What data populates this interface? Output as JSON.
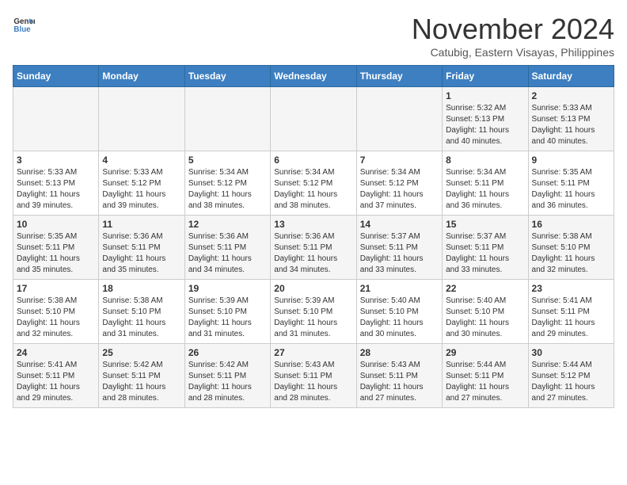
{
  "header": {
    "logo_line1": "General",
    "logo_line2": "Blue",
    "month": "November 2024",
    "location": "Catubig, Eastern Visayas, Philippines"
  },
  "weekdays": [
    "Sunday",
    "Monday",
    "Tuesday",
    "Wednesday",
    "Thursday",
    "Friday",
    "Saturday"
  ],
  "weeks": [
    [
      {
        "day": "",
        "info": ""
      },
      {
        "day": "",
        "info": ""
      },
      {
        "day": "",
        "info": ""
      },
      {
        "day": "",
        "info": ""
      },
      {
        "day": "",
        "info": ""
      },
      {
        "day": "1",
        "info": "Sunrise: 5:32 AM\nSunset: 5:13 PM\nDaylight: 11 hours\nand 40 minutes."
      },
      {
        "day": "2",
        "info": "Sunrise: 5:33 AM\nSunset: 5:13 PM\nDaylight: 11 hours\nand 40 minutes."
      }
    ],
    [
      {
        "day": "3",
        "info": "Sunrise: 5:33 AM\nSunset: 5:13 PM\nDaylight: 11 hours\nand 39 minutes."
      },
      {
        "day": "4",
        "info": "Sunrise: 5:33 AM\nSunset: 5:12 PM\nDaylight: 11 hours\nand 39 minutes."
      },
      {
        "day": "5",
        "info": "Sunrise: 5:34 AM\nSunset: 5:12 PM\nDaylight: 11 hours\nand 38 minutes."
      },
      {
        "day": "6",
        "info": "Sunrise: 5:34 AM\nSunset: 5:12 PM\nDaylight: 11 hours\nand 38 minutes."
      },
      {
        "day": "7",
        "info": "Sunrise: 5:34 AM\nSunset: 5:12 PM\nDaylight: 11 hours\nand 37 minutes."
      },
      {
        "day": "8",
        "info": "Sunrise: 5:34 AM\nSunset: 5:11 PM\nDaylight: 11 hours\nand 36 minutes."
      },
      {
        "day": "9",
        "info": "Sunrise: 5:35 AM\nSunset: 5:11 PM\nDaylight: 11 hours\nand 36 minutes."
      }
    ],
    [
      {
        "day": "10",
        "info": "Sunrise: 5:35 AM\nSunset: 5:11 PM\nDaylight: 11 hours\nand 35 minutes."
      },
      {
        "day": "11",
        "info": "Sunrise: 5:36 AM\nSunset: 5:11 PM\nDaylight: 11 hours\nand 35 minutes."
      },
      {
        "day": "12",
        "info": "Sunrise: 5:36 AM\nSunset: 5:11 PM\nDaylight: 11 hours\nand 34 minutes."
      },
      {
        "day": "13",
        "info": "Sunrise: 5:36 AM\nSunset: 5:11 PM\nDaylight: 11 hours\nand 34 minutes."
      },
      {
        "day": "14",
        "info": "Sunrise: 5:37 AM\nSunset: 5:11 PM\nDaylight: 11 hours\nand 33 minutes."
      },
      {
        "day": "15",
        "info": "Sunrise: 5:37 AM\nSunset: 5:11 PM\nDaylight: 11 hours\nand 33 minutes."
      },
      {
        "day": "16",
        "info": "Sunrise: 5:38 AM\nSunset: 5:10 PM\nDaylight: 11 hours\nand 32 minutes."
      }
    ],
    [
      {
        "day": "17",
        "info": "Sunrise: 5:38 AM\nSunset: 5:10 PM\nDaylight: 11 hours\nand 32 minutes."
      },
      {
        "day": "18",
        "info": "Sunrise: 5:38 AM\nSunset: 5:10 PM\nDaylight: 11 hours\nand 31 minutes."
      },
      {
        "day": "19",
        "info": "Sunrise: 5:39 AM\nSunset: 5:10 PM\nDaylight: 11 hours\nand 31 minutes."
      },
      {
        "day": "20",
        "info": "Sunrise: 5:39 AM\nSunset: 5:10 PM\nDaylight: 11 hours\nand 31 minutes."
      },
      {
        "day": "21",
        "info": "Sunrise: 5:40 AM\nSunset: 5:10 PM\nDaylight: 11 hours\nand 30 minutes."
      },
      {
        "day": "22",
        "info": "Sunrise: 5:40 AM\nSunset: 5:10 PM\nDaylight: 11 hours\nand 30 minutes."
      },
      {
        "day": "23",
        "info": "Sunrise: 5:41 AM\nSunset: 5:11 PM\nDaylight: 11 hours\nand 29 minutes."
      }
    ],
    [
      {
        "day": "24",
        "info": "Sunrise: 5:41 AM\nSunset: 5:11 PM\nDaylight: 11 hours\nand 29 minutes."
      },
      {
        "day": "25",
        "info": "Sunrise: 5:42 AM\nSunset: 5:11 PM\nDaylight: 11 hours\nand 28 minutes."
      },
      {
        "day": "26",
        "info": "Sunrise: 5:42 AM\nSunset: 5:11 PM\nDaylight: 11 hours\nand 28 minutes."
      },
      {
        "day": "27",
        "info": "Sunrise: 5:43 AM\nSunset: 5:11 PM\nDaylight: 11 hours\nand 28 minutes."
      },
      {
        "day": "28",
        "info": "Sunrise: 5:43 AM\nSunset: 5:11 PM\nDaylight: 11 hours\nand 27 minutes."
      },
      {
        "day": "29",
        "info": "Sunrise: 5:44 AM\nSunset: 5:11 PM\nDaylight: 11 hours\nand 27 minutes."
      },
      {
        "day": "30",
        "info": "Sunrise: 5:44 AM\nSunset: 5:12 PM\nDaylight: 11 hours\nand 27 minutes."
      }
    ]
  ]
}
